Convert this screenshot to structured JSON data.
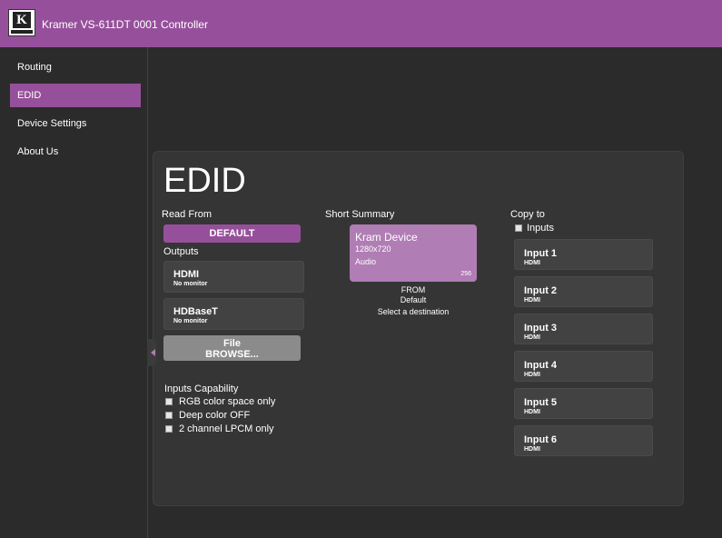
{
  "header": {
    "title": "Kramer VS-611DT 0001 Controller",
    "logo_letter": "K"
  },
  "sidebar": {
    "items": [
      {
        "label": "Routing",
        "active": false
      },
      {
        "label": "EDID",
        "active": true
      },
      {
        "label": "Device Settings",
        "active": false
      },
      {
        "label": "About Us",
        "active": false
      }
    ]
  },
  "edid": {
    "heading": "EDID",
    "read_from_label": "Read From",
    "default_btn": "DEFAULT",
    "outputs_label": "Outputs",
    "outputs": [
      {
        "name": "HDMI",
        "status": "No monitor"
      },
      {
        "name": "HDBaseT",
        "status": "No monitor"
      }
    ],
    "file_label": "File",
    "browse_label": "BROWSE...",
    "inputs_capability_label": "Inputs Capability",
    "capabilities": [
      {
        "label": "RGB color space only",
        "checked": false
      },
      {
        "label": "Deep color OFF",
        "checked": false
      },
      {
        "label": "2 channel LPCM only",
        "checked": false
      }
    ],
    "short_summary_label": "Short Summary",
    "summary": {
      "device": "Kram Device",
      "resolution": "1280x720",
      "audio": "Audio",
      "number": "256"
    },
    "from_label": "FROM",
    "from_value": "Default",
    "select_dest": "Select a destination",
    "copy_to_label": "Copy to",
    "inputs_check_label": "Inputs",
    "inputs": [
      {
        "name": "Input 1",
        "type": "HDMI"
      },
      {
        "name": "Input 2",
        "type": "HDMI"
      },
      {
        "name": "Input 3",
        "type": "HDMI"
      },
      {
        "name": "Input 4",
        "type": "HDMI"
      },
      {
        "name": "Input 5",
        "type": "HDMI"
      },
      {
        "name": "Input 6",
        "type": "HDMI"
      }
    ]
  },
  "colors": {
    "accent": "#96509b",
    "summary_card": "#b07db4",
    "background": "#2b2b2b"
  }
}
